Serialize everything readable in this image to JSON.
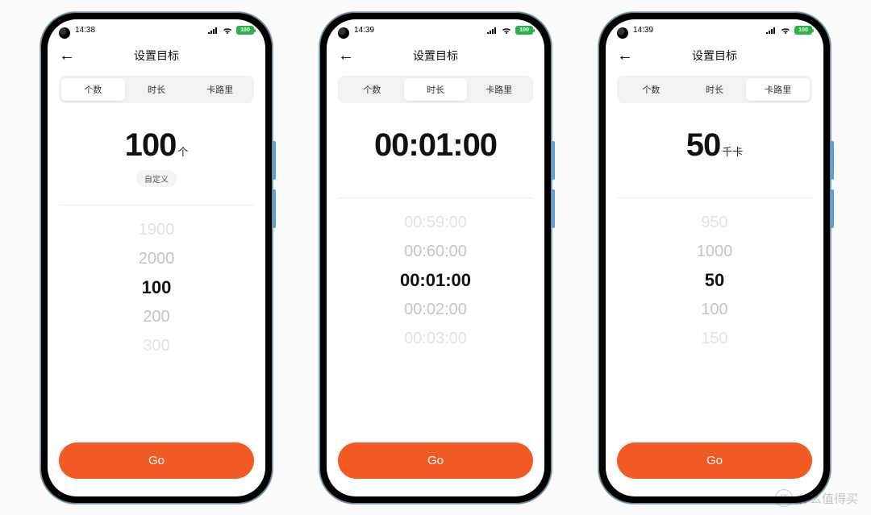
{
  "colors": {
    "accent": "#f15a24",
    "battery": "#2bb14a"
  },
  "watermark": {
    "badge": "值",
    "text": "什么值得买"
  },
  "phones": [
    {
      "status": {
        "time": "14:38",
        "battery": "100"
      },
      "nav": {
        "title": "设置目标"
      },
      "tabs": [
        "个数",
        "时长",
        "卡路里"
      ],
      "active_tab": 0,
      "hero": {
        "value": "100",
        "unit": "个",
        "custom_label": "自定义",
        "show_custom": true
      },
      "picker": [
        "1900",
        "2000",
        "100",
        "200",
        "300"
      ],
      "go_label": "Go"
    },
    {
      "status": {
        "time": "14:39",
        "battery": "100"
      },
      "nav": {
        "title": "设置目标"
      },
      "tabs": [
        "个数",
        "时长",
        "卡路里"
      ],
      "active_tab": 1,
      "hero": {
        "value": "00:01:00",
        "unit": "",
        "show_custom": false
      },
      "picker": [
        "00:59:00",
        "00:60:00",
        "00:01:00",
        "00:02:00",
        "00:03:00"
      ],
      "go_label": "Go"
    },
    {
      "status": {
        "time": "14:39",
        "battery": "100"
      },
      "nav": {
        "title": "设置目标"
      },
      "tabs": [
        "个数",
        "时长",
        "卡路里"
      ],
      "active_tab": 2,
      "hero": {
        "value": "50",
        "unit": "千卡",
        "show_custom": false
      },
      "picker": [
        "950",
        "1000",
        "50",
        "100",
        "150"
      ],
      "go_label": "Go"
    }
  ]
}
